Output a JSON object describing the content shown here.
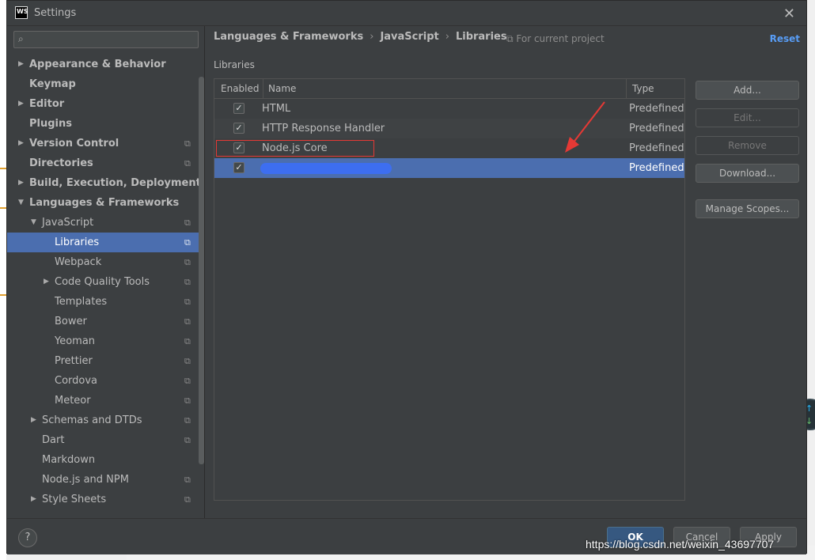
{
  "window": {
    "title": "Settings",
    "logo": "WS"
  },
  "search": {
    "placeholder": ""
  },
  "sidebar": {
    "items": [
      {
        "label": "Appearance & Behavior"
      },
      {
        "label": "Keymap"
      },
      {
        "label": "Editor"
      },
      {
        "label": "Plugins"
      },
      {
        "label": "Version Control"
      },
      {
        "label": "Directories"
      },
      {
        "label": "Build, Execution, Deployment"
      },
      {
        "label": "Languages & Frameworks"
      },
      {
        "label": "JavaScript"
      },
      {
        "label": "Libraries"
      },
      {
        "label": "Webpack"
      },
      {
        "label": "Code Quality Tools"
      },
      {
        "label": "Templates"
      },
      {
        "label": "Bower"
      },
      {
        "label": "Yeoman"
      },
      {
        "label": "Prettier"
      },
      {
        "label": "Cordova"
      },
      {
        "label": "Meteor"
      },
      {
        "label": "Schemas and DTDs"
      },
      {
        "label": "Dart"
      },
      {
        "label": "Markdown"
      },
      {
        "label": "Node.js and NPM"
      },
      {
        "label": "Style Sheets"
      }
    ]
  },
  "breadcrumb": {
    "part1": "Languages & Frameworks",
    "part2": "JavaScript",
    "part3": "Libraries",
    "separator": "›"
  },
  "scope_label": "For current project",
  "reset_label": "Reset",
  "section_label": "Libraries",
  "table": {
    "headers": {
      "enabled": "Enabled",
      "name": "Name",
      "type": "Type"
    },
    "rows": [
      {
        "name": "HTML",
        "type": "Predefined",
        "enabled": true
      },
      {
        "name": "HTTP Response Handler",
        "type": "Predefined",
        "enabled": true
      },
      {
        "name": "Node.js Core",
        "type": "Predefined",
        "enabled": true
      },
      {
        "name": "",
        "type": "Predefined",
        "enabled": true
      }
    ]
  },
  "buttons": {
    "add": "Add...",
    "edit": "Edit...",
    "remove": "Remove",
    "download": "Download...",
    "manage_scopes": "Manage Scopes..."
  },
  "footer": {
    "help": "?",
    "ok": "OK",
    "cancel": "Cancel",
    "apply": "Apply"
  },
  "watermark": "https://blog.csdn.net/weixin_43697707",
  "colors": {
    "selection": "#4b6eaf",
    "accent": "#589df6",
    "highlight_box": "#e53935",
    "annotation_arrow": "#e53935"
  }
}
